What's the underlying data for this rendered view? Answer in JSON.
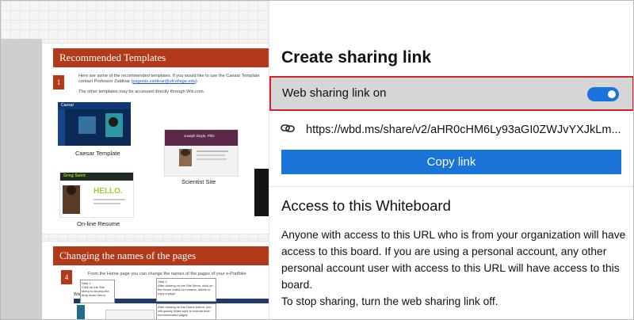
{
  "whiteboard": {
    "section1": {
      "header": "Recommended Templates",
      "number": "1",
      "intro_line1": "Here are some of the recommended templates. If you would like to use the Caesar Template",
      "intro_line2_prefix": "contact Professor Zaldivar (",
      "intro_email": "pagonis.zaldivar@ufcollege.edu",
      "intro_line2_suffix": ").",
      "other_templates": "The other templates may be accessed directly through Wix.com.",
      "thumb_caesar_label": "Caesar",
      "caption_caesar": "Caesar Template",
      "thumb_scientist_name": "Joseph Doyle, PhD",
      "caption_scientist": "Scientist Site",
      "thumb_resume_name": "Greg Saint",
      "thumb_resume_hello": "HELLO.",
      "caption_resume": "On-line Resume"
    },
    "section2": {
      "header": "Changing the names of the pages",
      "number": "4",
      "intro": "From the Home page you can change the names of the pages of your e-Portfolio",
      "step1_title": "Step 1",
      "step1_text": "Click on the Site Menu to access the drop down menu",
      "step2_title": "Step 2",
      "step2_text": "After clicking on the Site Menu, click on the Home button to rename, delete or copy a page",
      "step3_text": "After clicking on the Home button, you will quickly make sure to include their recommended pages",
      "wix_label": "Wix"
    }
  },
  "panel": {
    "title": "Create sharing link",
    "toggle_label": "Web sharing link on",
    "toggle_on": true,
    "link_icon": "link-icon",
    "link_url": "https://wbd.ms/share/v2/aHR0cHM6Ly93aGI0ZWJvYXJkLm...",
    "copy_button": "Copy link",
    "access_title": "Access to this Whiteboard",
    "access_line1": "Anyone with access to this URL who is from your organization will have access to this board. If you are using a personal account, any other personal account user with access to this URL will have access to this board.",
    "access_line2": "To stop sharing, turn the web sharing link off."
  },
  "colors": {
    "accent": "#1a73d9",
    "highlight_border": "#d2232a",
    "doc_header": "#b23a1a"
  }
}
